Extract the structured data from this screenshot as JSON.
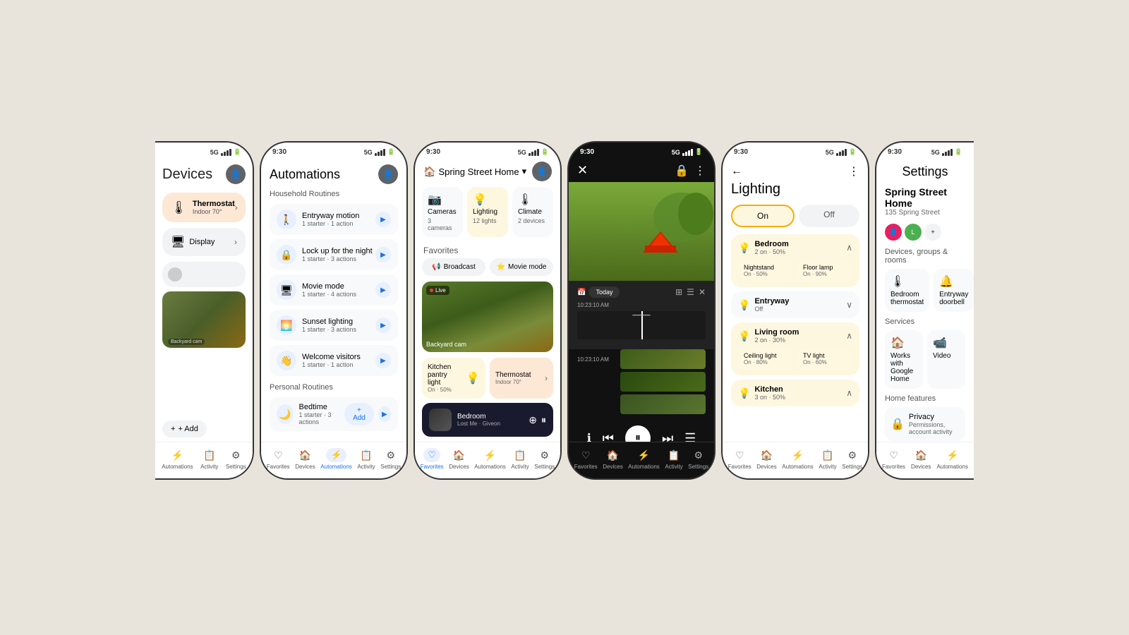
{
  "bg": "#e8e4dc",
  "phone1": {
    "title": "Devices",
    "thermostat": {
      "name": "Thermostat",
      "status": "Indoor 70°"
    },
    "display": {
      "name": "Display",
      "chevron": "›"
    },
    "camera_label": "Backyard cam",
    "add_label": "+ Add",
    "nav": [
      "Automations",
      "Activity",
      "Settings"
    ]
  },
  "phone2": {
    "title": "Automations",
    "section1": "Household Routines",
    "routines": [
      {
        "name": "Entryway motion",
        "sub": "1 starter · 1 action",
        "icon": "🚶"
      },
      {
        "name": "Lock up for the night",
        "sub": "1 starter · 3 actions",
        "icon": "🔒"
      },
      {
        "name": "Movie mode",
        "sub": "1 starter · 4 actions",
        "icon": "🖥"
      },
      {
        "name": "Sunset lighting",
        "sub": "1 starter · 3 actions",
        "icon": "🌅"
      },
      {
        "name": "Welcome visitors",
        "sub": "1 starter · 1 action",
        "icon": "👋"
      }
    ],
    "section2": "Personal Routines",
    "personal": [
      {
        "name": "Bedtime",
        "sub": "1 starter · 3 actions",
        "icon": "🌙"
      }
    ],
    "add_label": "+ Add",
    "nav": [
      "Favorites",
      "Devices",
      "Automations",
      "Activity",
      "Settings"
    ]
  },
  "phone3": {
    "home_name": "Spring Street Home",
    "categories": [
      {
        "name": "Cameras",
        "count": "3 cameras",
        "icon": "📷",
        "active": false
      },
      {
        "name": "Lighting",
        "count": "12 lights",
        "icon": "💡",
        "active": true
      },
      {
        "name": "Climate",
        "count": "2 devices",
        "icon": "🌡",
        "active": false
      }
    ],
    "favorites_label": "Favorites",
    "fav_buttons": [
      "Broadcast",
      "Movie mode"
    ],
    "camera_name": "Backyard cam",
    "device1": {
      "name": "Kitchen pantry light",
      "status": "On · 50%"
    },
    "device2": {
      "name": "Thermostat",
      "status": "Indoor 70°"
    },
    "music": {
      "song": "Bedroom",
      "artist": "Lost Me · Giveon"
    },
    "nav": [
      "Favorites",
      "Devices",
      "Automations",
      "Activity",
      "Settings"
    ]
  },
  "phone4": {
    "time": "9:30",
    "today_label": "Today",
    "timeline_time": "10:23:10 AM",
    "thumbnails": [
      {
        "time": "10:23:10 AM"
      },
      {
        "time": ""
      },
      {
        "time": ""
      }
    ]
  },
  "phone5": {
    "title": "Lighting",
    "toggle_on": "On",
    "toggle_off": "Off",
    "rooms": [
      {
        "name": "Bedroom",
        "status": "2 on · 50%",
        "on": true,
        "expanded": false,
        "sublights": [
          {
            "name": "Nightstand",
            "status": "On · 50%"
          },
          {
            "name": "Floor lamp",
            "status": "On · 90%"
          }
        ]
      },
      {
        "name": "Entryway",
        "status": "Off",
        "on": false,
        "expanded": false
      },
      {
        "name": "Living room",
        "status": "2 on · 30%",
        "on": true,
        "expanded": true,
        "sublights": [
          {
            "name": "Ceiling light",
            "status": "On · 80%"
          },
          {
            "name": "TV light",
            "status": "On · 60%"
          }
        ]
      },
      {
        "name": "Kitchen",
        "status": "3 on · 50%",
        "on": true,
        "expanded": false
      }
    ],
    "nav": [
      "Favorites",
      "Devices",
      "Automations",
      "Activity",
      "Settings"
    ]
  },
  "phone6": {
    "title": "Settings",
    "home_name": "Spring Street Home",
    "home_addr": "135 Spring Street",
    "devices_section": "Devices, groups & rooms",
    "devices": [
      {
        "name": "Bedroom thermostat",
        "icon": "🌡"
      },
      {
        "name": "Entryway doorbell",
        "icon": "🔔"
      }
    ],
    "services_section": "Services",
    "services": [
      {
        "name": "Works with Google Home",
        "icon": "🏠"
      },
      {
        "name": "Video",
        "icon": "📹"
      }
    ],
    "home_features": "Home features",
    "features": [
      {
        "name": "Privacy",
        "sub": "Permissions, account activity",
        "icon": "🔒"
      }
    ],
    "nav": [
      "Favorites",
      "Devices",
      "Automations"
    ]
  }
}
